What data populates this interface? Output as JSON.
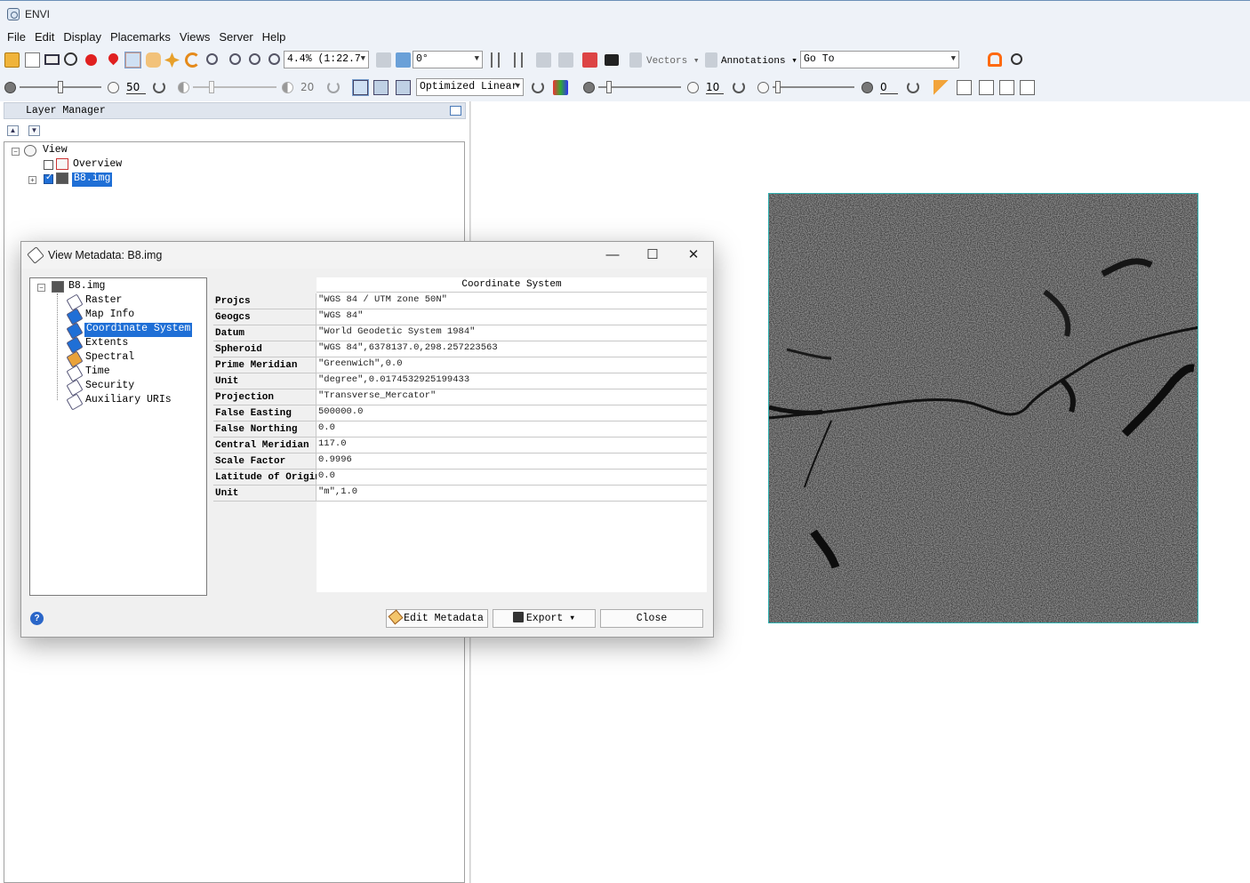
{
  "app": {
    "title": "ENVI"
  },
  "menu": [
    "File",
    "Edit",
    "Display",
    "Placemarks",
    "Views",
    "Server",
    "Help"
  ],
  "toolbar1": {
    "zoom_value": "4.4% (1:22.7",
    "rotation_value": "0°",
    "vectors_label": "Vectors",
    "annotations_label": "Annotations",
    "goto_value": "Go To"
  },
  "toolbar2": {
    "brightness_value": "50",
    "contrast_value": "20",
    "stretch_value": "Optimized Linear",
    "sharpen_value": "10",
    "transparency_value": "0"
  },
  "layer_manager": {
    "title": "Layer Manager",
    "tree": {
      "root": "View",
      "overview": "Overview",
      "layer": "B8.img"
    }
  },
  "dialog": {
    "title": "View Metadata: B8.img",
    "tree": {
      "root": "B8.img",
      "items": [
        "Raster",
        "Map Info",
        "Coordinate System",
        "Extents",
        "Spectral",
        "Time",
        "Security",
        "Auxiliary URIs"
      ],
      "selected": "Coordinate System"
    },
    "column_header": "Coordinate System",
    "rows": [
      {
        "key": "Projcs",
        "value": "\"WGS 84 / UTM zone 50N\""
      },
      {
        "key": "Geogcs",
        "value": "\"WGS 84\""
      },
      {
        "key": "Datum",
        "value": "\"World Geodetic System 1984\""
      },
      {
        "key": "Spheroid",
        "value": "\"WGS 84\",6378137.0,298.257223563"
      },
      {
        "key": "Prime Meridian",
        "value": "\"Greenwich\",0.0"
      },
      {
        "key": "Unit",
        "value": "\"degree\",0.0174532925199433"
      },
      {
        "key": "Projection",
        "value": "\"Transverse_Mercator\""
      },
      {
        "key": "False Easting",
        "value": "500000.0"
      },
      {
        "key": "False Northing",
        "value": "0.0"
      },
      {
        "key": "Central Meridian",
        "value": "117.0"
      },
      {
        "key": "Scale Factor",
        "value": "0.9996"
      },
      {
        "key": "Latitude of Origin",
        "value": "0.0"
      },
      {
        "key": "Unit",
        "value": "\"m\",1.0"
      }
    ],
    "buttons": {
      "edit": "Edit Metadata",
      "export": "Export",
      "close": "Close",
      "help": "?"
    }
  },
  "colors": {
    "selection": "#1f6fd6",
    "image_border": "#2fb0b0",
    "chrome": "#eef2f8"
  }
}
